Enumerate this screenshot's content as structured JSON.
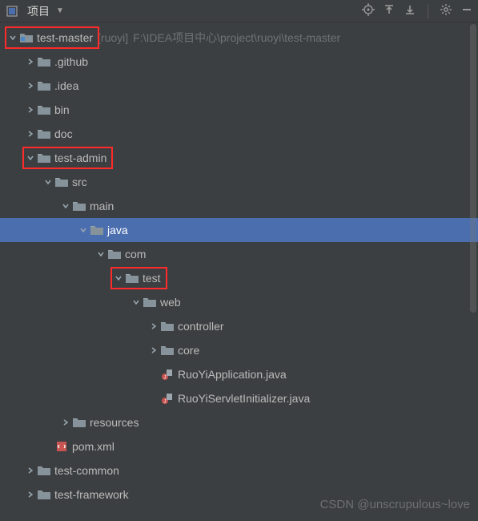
{
  "header": {
    "title": "项目",
    "dropdown": "▼",
    "icons": [
      "target",
      "collapse",
      "expand",
      "gear",
      "minimize"
    ]
  },
  "tree": [
    {
      "indent": 0,
      "arrow": "down",
      "icon": "project",
      "label": "test-master",
      "suffix": "[ruoyi]",
      "path": "F:\\IDEA项目中心\\project\\ruoyi\\test-master",
      "hl": true
    },
    {
      "indent": 1,
      "arrow": "right",
      "icon": "folder",
      "label": ".github"
    },
    {
      "indent": 1,
      "arrow": "right",
      "icon": "folder",
      "label": ".idea"
    },
    {
      "indent": 1,
      "arrow": "right",
      "icon": "folder",
      "label": "bin"
    },
    {
      "indent": 1,
      "arrow": "right",
      "icon": "folder",
      "label": "doc"
    },
    {
      "indent": 1,
      "arrow": "down",
      "icon": "folder",
      "label": "test-admin",
      "hl": true
    },
    {
      "indent": 2,
      "arrow": "down",
      "icon": "folder",
      "label": "src"
    },
    {
      "indent": 3,
      "arrow": "down",
      "icon": "folder",
      "label": "main"
    },
    {
      "indent": 4,
      "arrow": "down",
      "icon": "folder",
      "label": "java",
      "selected": true
    },
    {
      "indent": 5,
      "arrow": "down",
      "icon": "folder",
      "label": "com"
    },
    {
      "indent": 6,
      "arrow": "down",
      "icon": "folder",
      "label": "test",
      "hl": true
    },
    {
      "indent": 7,
      "arrow": "down",
      "icon": "folder",
      "label": "web"
    },
    {
      "indent": 8,
      "arrow": "right",
      "icon": "folder",
      "label": "controller"
    },
    {
      "indent": 8,
      "arrow": "right",
      "icon": "folder",
      "label": "core"
    },
    {
      "indent": 8,
      "arrow": "none",
      "icon": "java",
      "label": "RuoYiApplication.java"
    },
    {
      "indent": 8,
      "arrow": "none",
      "icon": "java",
      "label": "RuoYiServletInitializer.java"
    },
    {
      "indent": 3,
      "arrow": "right",
      "icon": "folder",
      "label": "resources"
    },
    {
      "indent": 2,
      "arrow": "none",
      "icon": "xml",
      "label": "pom.xml"
    },
    {
      "indent": 1,
      "arrow": "right",
      "icon": "folder",
      "label": "test-common"
    },
    {
      "indent": 1,
      "arrow": "right",
      "icon": "folder",
      "label": "test-framework"
    }
  ],
  "watermark": "CSDN @unscrupulous~love"
}
